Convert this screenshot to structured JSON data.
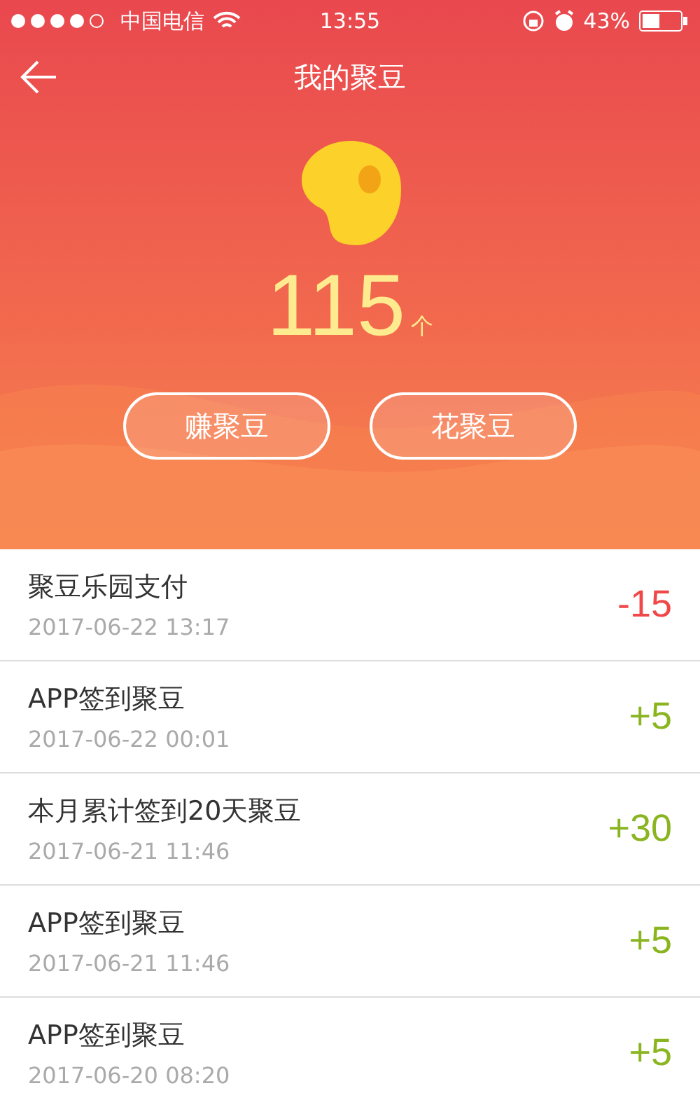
{
  "status_bar": {
    "carrier": "中国电信",
    "time": "13:55",
    "battery": "43%"
  },
  "nav": {
    "title": "我的聚豆"
  },
  "balance": {
    "amount": "115",
    "unit": "个"
  },
  "actions": [
    {
      "label": "赚聚豆"
    },
    {
      "label": "花聚豆"
    }
  ],
  "records": [
    {
      "title": "聚豆乐园支付",
      "time": "2017-06-22 13:17",
      "amount": "-15",
      "kind": "debit"
    },
    {
      "title": "APP签到聚豆",
      "time": "2017-06-22 00:01",
      "amount": "+5",
      "kind": "credit"
    },
    {
      "title": "本月累计签到20天聚豆",
      "time": "2017-06-21 11:46",
      "amount": "+30",
      "kind": "credit"
    },
    {
      "title": "APP签到聚豆",
      "time": "2017-06-21 11:46",
      "amount": "+5",
      "kind": "credit"
    },
    {
      "title": "APP签到聚豆",
      "time": "2017-06-20 08:20",
      "amount": "+5",
      "kind": "credit"
    }
  ]
}
